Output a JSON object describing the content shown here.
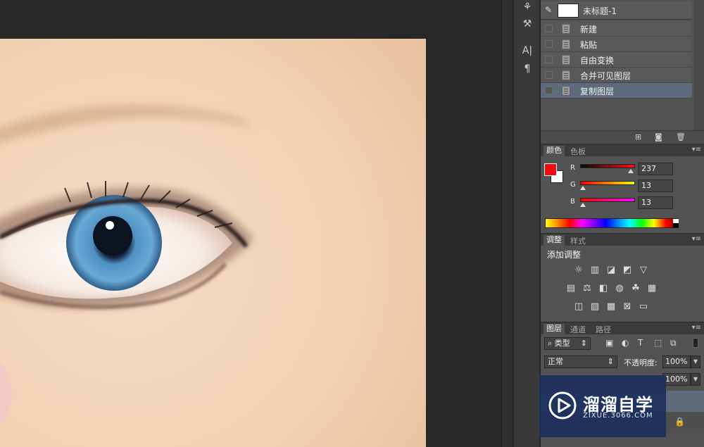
{
  "history": {
    "snapshot_label": "未标题-1",
    "steps": [
      {
        "label": "新建"
      },
      {
        "label": "粘贴"
      },
      {
        "label": "自由变换"
      },
      {
        "label": "合并可见图层"
      },
      {
        "label": "复制图层"
      }
    ],
    "selected_step": "复制图层"
  },
  "color_panel": {
    "tabs": [
      "颜色",
      "色板"
    ],
    "active_tab": "颜色",
    "foreground_color": "#ed0d0d",
    "background_color": "#ffffff",
    "channels": [
      {
        "label": "R",
        "value": "237",
        "level": 237
      },
      {
        "label": "G",
        "value": "13",
        "level": 13
      },
      {
        "label": "B",
        "value": "13",
        "level": 13
      }
    ]
  },
  "adjustments_panel": {
    "tabs": [
      "调整",
      "样式"
    ],
    "active_tab": "调整",
    "title": "添加调整"
  },
  "layers_panel": {
    "tabs": [
      "图层",
      "通道",
      "路径"
    ],
    "active_tab": "图层",
    "filter_label": "类型",
    "blend_mode": "正常",
    "opacity_label": "不透明度:",
    "opacity_value": "100%",
    "fill_value": "100%"
  },
  "watermark": {
    "title": "溜溜自学",
    "subtitle": "ZIXUE.3066.COM"
  },
  "colors": {
    "panel_bg": "#535353",
    "selection": "#5f6b7c",
    "workspace_bg": "#282828"
  }
}
